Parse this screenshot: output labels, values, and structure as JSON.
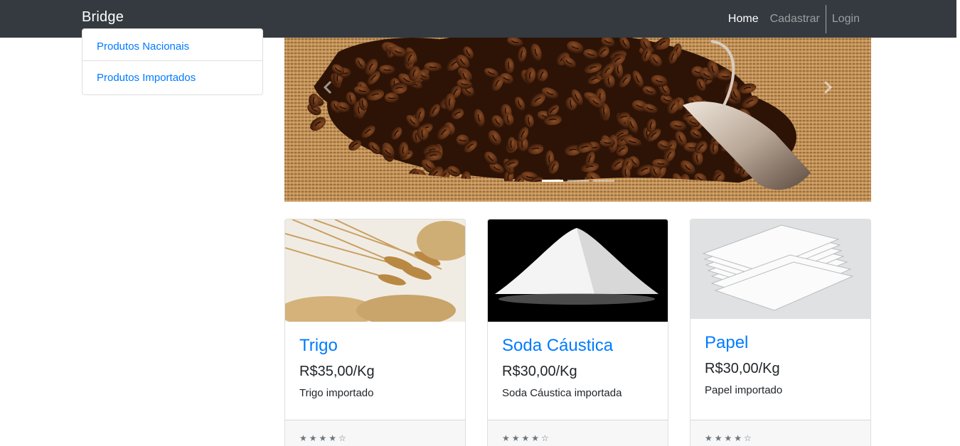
{
  "navbar": {
    "brand": "Bridge",
    "links": [
      "Home",
      "Cadastrar",
      "Login"
    ]
  },
  "sidebar": {
    "items": [
      {
        "label": "Produtos Nacionais"
      },
      {
        "label": "Produtos Importados"
      }
    ]
  },
  "carousel": {
    "slides": 3,
    "active_slide": 1,
    "image": "coffee-beans-in-burlap-sack"
  },
  "products": [
    {
      "title": "Trigo",
      "price": "R$35,00/Kg",
      "description": "Trigo importado",
      "rating": "★★★★☆",
      "image": "wheat-grains"
    },
    {
      "title": "Soda Cáustica",
      "price": "R$30,00/Kg",
      "description": "Soda Cáustica importada",
      "rating": "★★★★☆",
      "image": "white-powder-pile"
    },
    {
      "title": "Papel",
      "price": "R$30,00/Kg",
      "description": "Papel importado",
      "rating": "★★★★☆",
      "image": "paper-stack"
    }
  ],
  "colors": {
    "navbar": "#343a40",
    "link": "#007bff",
    "text": "#212529"
  }
}
